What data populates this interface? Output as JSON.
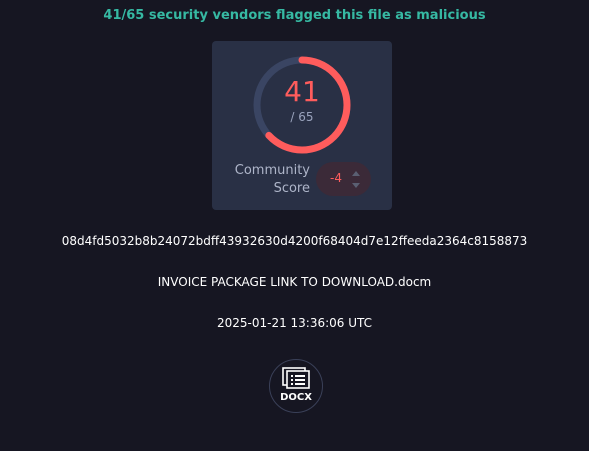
{
  "headline": "41/65 security vendors flagged this file as malicious",
  "detection": {
    "positives": "41",
    "total_label": "/ 65",
    "positives_count": 41,
    "total_count": 65,
    "ring_color": "#ff5c5c",
    "ring_track_color": "#3a4563"
  },
  "community": {
    "label_line1": "Community",
    "label_line2": "Score",
    "value": "-4",
    "value_color": "#ff5c5c"
  },
  "file": {
    "hash": "08d4fd5032b8b24072bdff43932630d4200f68404d7e12ffeeda2364c8158873",
    "name": "INVOICE PACKAGE LINK TO DOWNLOAD.docm",
    "date": "2025-01-21 13:36:06 UTC",
    "type_label": "DOCX",
    "type_icon": "document-icon"
  },
  "colors": {
    "background": "#161622",
    "card": "#293045",
    "headline": "#36b9a3"
  }
}
